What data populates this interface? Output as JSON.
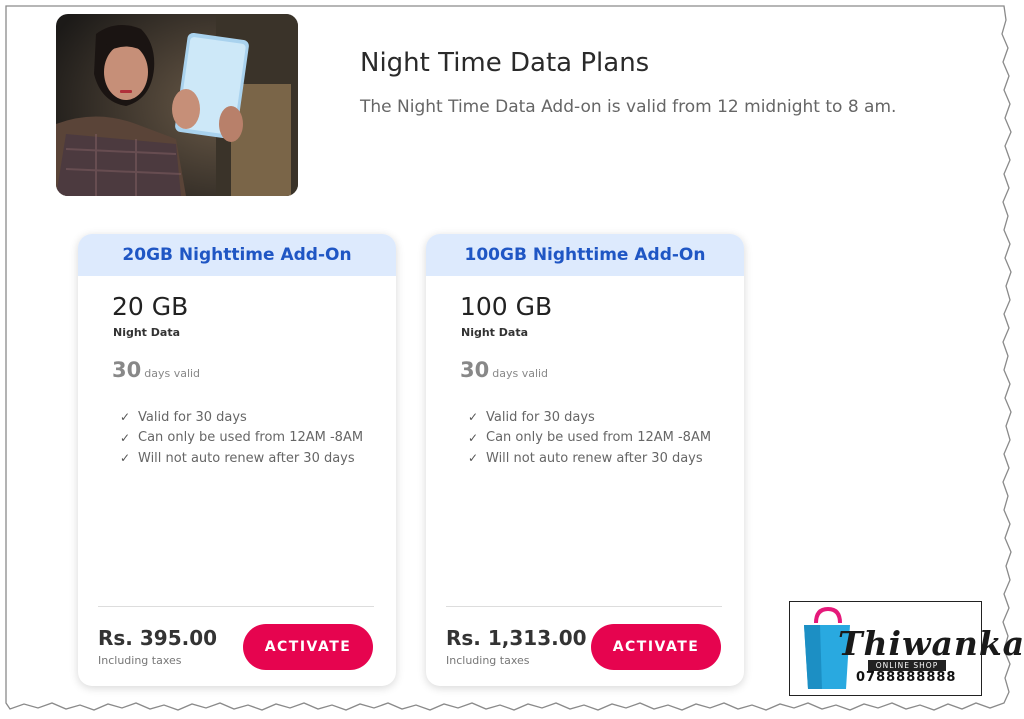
{
  "header": {
    "title": "Night Time Data Plans",
    "subtitle": "The Night Time Data Add-on is valid from 12 midnight to 8 am."
  },
  "plans": [
    {
      "name": "20GB Nighttime Add-On",
      "size": "20 GB",
      "size_label": "Night Data",
      "days": "30",
      "days_label": "days valid",
      "features": [
        "Valid for 30 days",
        "Can only be used from 12AM -8AM",
        "Will not auto renew after 30 days"
      ],
      "price": "Rs. 395.00",
      "tax_note": "Including taxes",
      "button": "ACTIVATE"
    },
    {
      "name": "100GB Nighttime Add-On",
      "size": "100 GB",
      "size_label": "Night Data",
      "days": "30",
      "days_label": "days valid",
      "features": [
        "Valid for 30 days",
        "Can only be used from 12AM -8AM",
        "Will not auto renew after 30 days"
      ],
      "price": "Rs. 1,313.00",
      "tax_note": "Including taxes",
      "button": "ACTIVATE"
    }
  ],
  "watermark": {
    "logo": "Thiwanka.lk",
    "tagline": "ONLINE SHOP",
    "phone": "0788888888"
  },
  "icons": {
    "check": "check-icon"
  },
  "colors": {
    "accent": "#e6044f",
    "plan_header_bg": "#ddeafd",
    "plan_header_text": "#1f56c4"
  }
}
